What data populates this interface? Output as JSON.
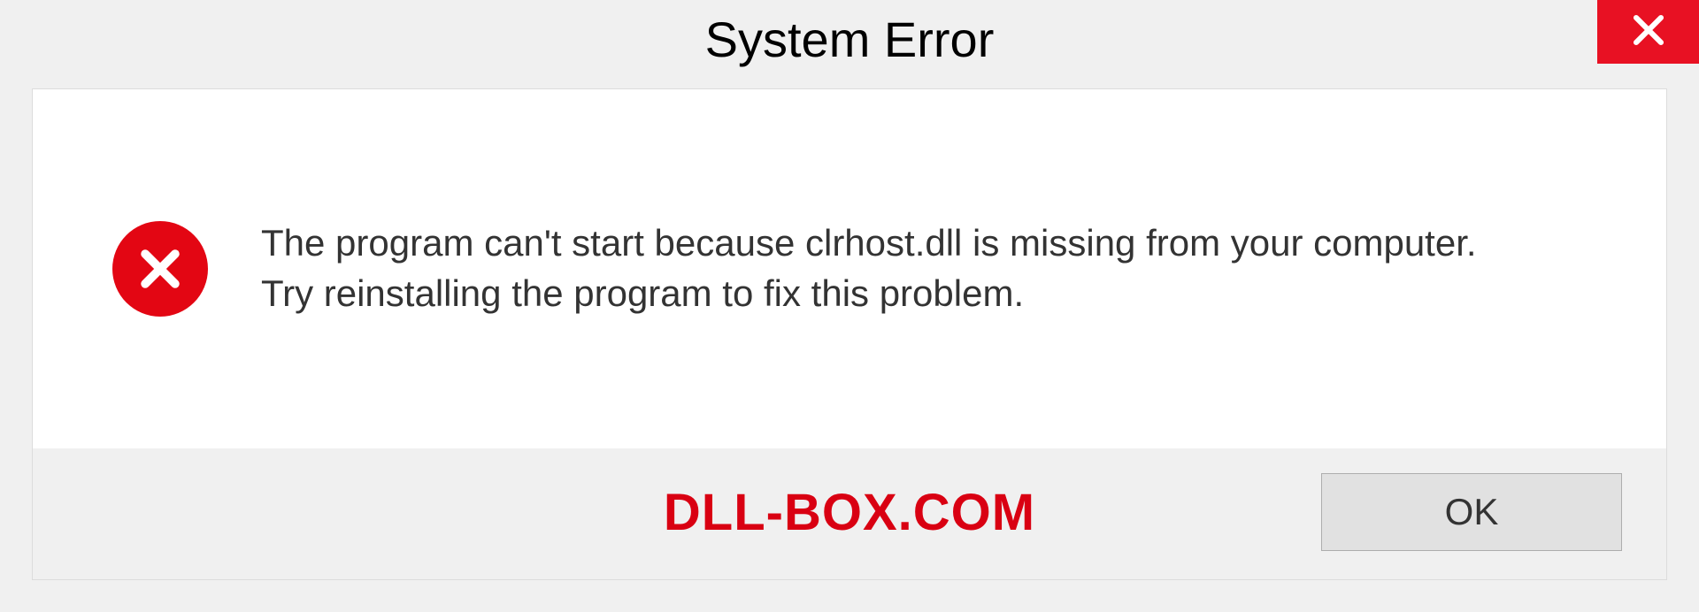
{
  "titlebar": {
    "title": "System Error"
  },
  "message": {
    "line1": "The program can't start because clrhost.dll is missing from your computer.",
    "line2": "Try reinstalling the program to fix this problem."
  },
  "footer": {
    "watermark": "DLL-BOX.COM",
    "ok_label": "OK"
  },
  "colors": {
    "close_bg": "#e81123",
    "error_icon_bg": "#e30613",
    "watermark_color": "#d90012"
  }
}
